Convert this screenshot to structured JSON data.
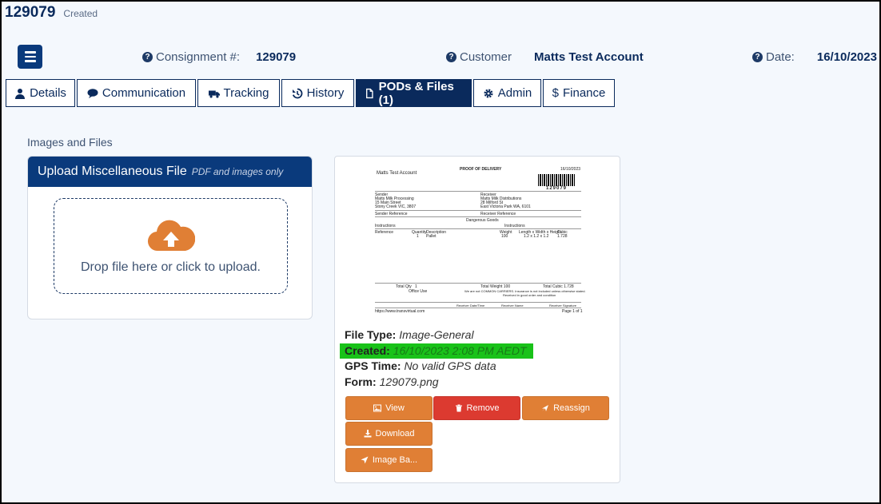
{
  "header": {
    "number": "129079",
    "status": "Created"
  },
  "meta": {
    "consignment_label": "Consignment #:",
    "consignment_value": "129079",
    "customer_label": "Customer",
    "customer_value": "Matts Test Account",
    "date_label": "Date:",
    "date_value": "16/10/2023"
  },
  "tabs": [
    {
      "label": "Details",
      "icon": "user-icon"
    },
    {
      "label": "Communication",
      "icon": "comment-icon"
    },
    {
      "label": "Tracking",
      "icon": "truck-icon"
    },
    {
      "label": "History",
      "icon": "history-icon"
    },
    {
      "label": "PODs & Files (1)",
      "icon": "file-icon",
      "active": true
    },
    {
      "label": "Admin",
      "icon": "gear-icon"
    },
    {
      "label": "Finance",
      "icon": "dollar-icon"
    }
  ],
  "section_title": "Images and Files",
  "upload": {
    "title": "Upload Miscellaneous File",
    "subtitle": "PDF and images only",
    "drop_text": "Drop file here or click to upload."
  },
  "file": {
    "preview": {
      "heading": "PROOF OF DELIVERY",
      "date": "16/10/2023",
      "account": "Matts Test Account",
      "barcode": "129079",
      "sender_label": "Sender",
      "sender_lines": [
        "Matts Milk Processing",
        "15 Main Street",
        "Stony Creek VIC, 3807"
      ],
      "receiver_label": "Receiver",
      "receiver_lines": [
        "Matts Milk Distributions",
        "28 Milford St",
        "East Victoria Park WA, 6101"
      ],
      "sender_ref": "Sender Reference",
      "receiver_ref": "Receiver Reference",
      "dangerous": "Dangerous Goods",
      "instructions": "Instructions",
      "cols": [
        "Reference",
        "Quantity",
        "Description",
        "Weight",
        "Length x Width x Height",
        "Cubic"
      ],
      "row": [
        "1",
        "Pallet",
        "100",
        "1.2 x 1.2 x 1.2",
        "1.728"
      ],
      "total_qty": "Total Qty",
      "total_qty_val": "1",
      "total_weight": "Total Weight 100",
      "total_cubic": "Total Cubic 1.728",
      "office": "Office Use",
      "carrier_note": "We are not COMMON CARRIERS. Insurance is not included unless otherwise stated.",
      "received_note": "Received in good order and condition",
      "receiver_date": "Receiver Date/Time",
      "receiver_name": "Receiver Name",
      "receiver_sig": "Receiver Signature",
      "url": "https://www.transvirtual.com",
      "page": "Page 1 of 1"
    },
    "type_label": "File Type:",
    "type_value": "Image-General",
    "created_label": "Created:",
    "created_value": "16/10/2023 2:08 PM AEDT",
    "gps_label": "GPS Time:",
    "gps_value": "No valid GPS data",
    "form_label": "Form:",
    "form_value": "129079.png",
    "buttons": {
      "view": "View",
      "remove": "Remove",
      "reassign": "Reassign",
      "download": "Download",
      "image_ba": "Image Ba..."
    }
  },
  "colors": {
    "navy": "#0a2a5c",
    "orange": "#e07f35",
    "red": "#dc3a30",
    "highlight": "#19c219"
  }
}
